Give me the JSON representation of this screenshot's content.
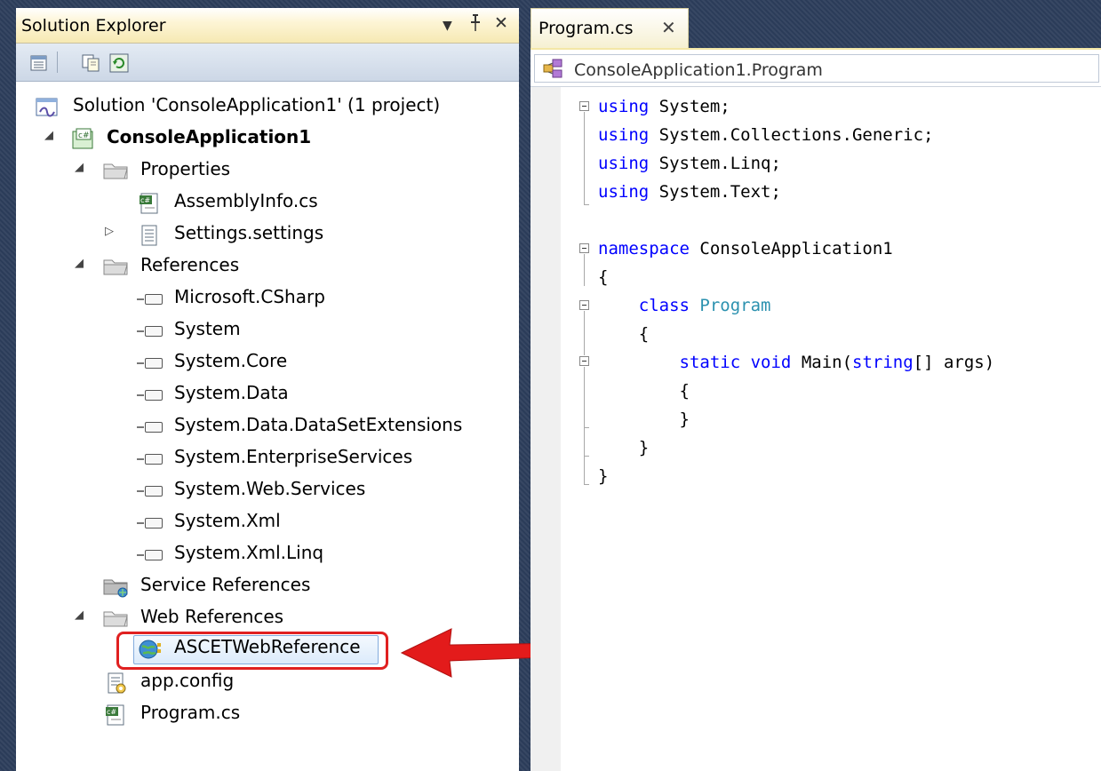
{
  "solution_explorer": {
    "title": "Solution Explorer",
    "controls": {
      "dropdown": "▼",
      "pin": "ᵖ",
      "close": "✕"
    },
    "toolbar": [
      {
        "name": "properties-button-icon"
      },
      {
        "name": "show-all-files-icon"
      },
      {
        "name": "refresh-icon"
      }
    ],
    "tree": {
      "solution": "Solution 'ConsoleApplication1' (1 project)",
      "project": "ConsoleApplication1",
      "properties": "Properties",
      "assembly_info": "AssemblyInfo.cs",
      "settings": "Settings.settings",
      "references": "References",
      "reference_items": [
        "Microsoft.CSharp",
        "System",
        "System.Core",
        "System.Data",
        "System.Data.DataSetExtensions",
        "System.EnterpriseServices",
        "System.Web.Services",
        "System.Xml",
        "System.Xml.Linq"
      ],
      "service_references": "Service References",
      "web_references": "Web References",
      "web_reference_item": "ASCETWebReference",
      "app_config": "app.config",
      "program_cs": "Program.cs"
    }
  },
  "editor": {
    "tab_label": "Program.cs",
    "tab_close": "✕",
    "nav_dropdown": "ConsoleApplication1.Program",
    "code": {
      "l1_kw": "using",
      "l1_rest": " System;",
      "l2_kw": "using",
      "l2_rest": " System.Collections.Generic;",
      "l3_kw": "using",
      "l3_rest": " System.Linq;",
      "l4_kw": "using",
      "l4_rest": " System.Text;",
      "l6_kw": "namespace",
      "l6_rest": " ConsoleApplication1",
      "l7": "{",
      "l8_kw": "class",
      "l8_type": "Program",
      "l9": "{",
      "l10_kw1": "static",
      "l10_kw2": "void",
      "l10_mid": " Main(",
      "l10_kw3": "string",
      "l10_rest": "[] args)",
      "l11": "{",
      "l12": "}",
      "l13": "}",
      "l14": "}"
    }
  },
  "colors": {
    "keyword": "#0000ff",
    "type": "#2b91af",
    "annotation_red": "#e02020",
    "selection_border": "#84acdd"
  }
}
